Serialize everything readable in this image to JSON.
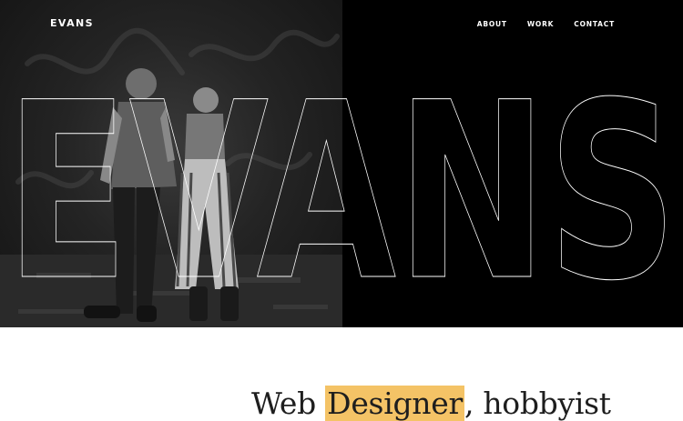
{
  "brand": {
    "name": "EVANS"
  },
  "nav": {
    "items": [
      "ABOUT",
      "WORK",
      "CONTACT"
    ]
  },
  "hero": {
    "outline_text": "EVANS"
  },
  "tagline": {
    "part1": "Web ",
    "highlight": "Designer",
    "part2": ", hobbyist"
  },
  "colors": {
    "hero_bg": "#000000",
    "highlight": "#f4c366",
    "text": "#1e1e1e"
  }
}
